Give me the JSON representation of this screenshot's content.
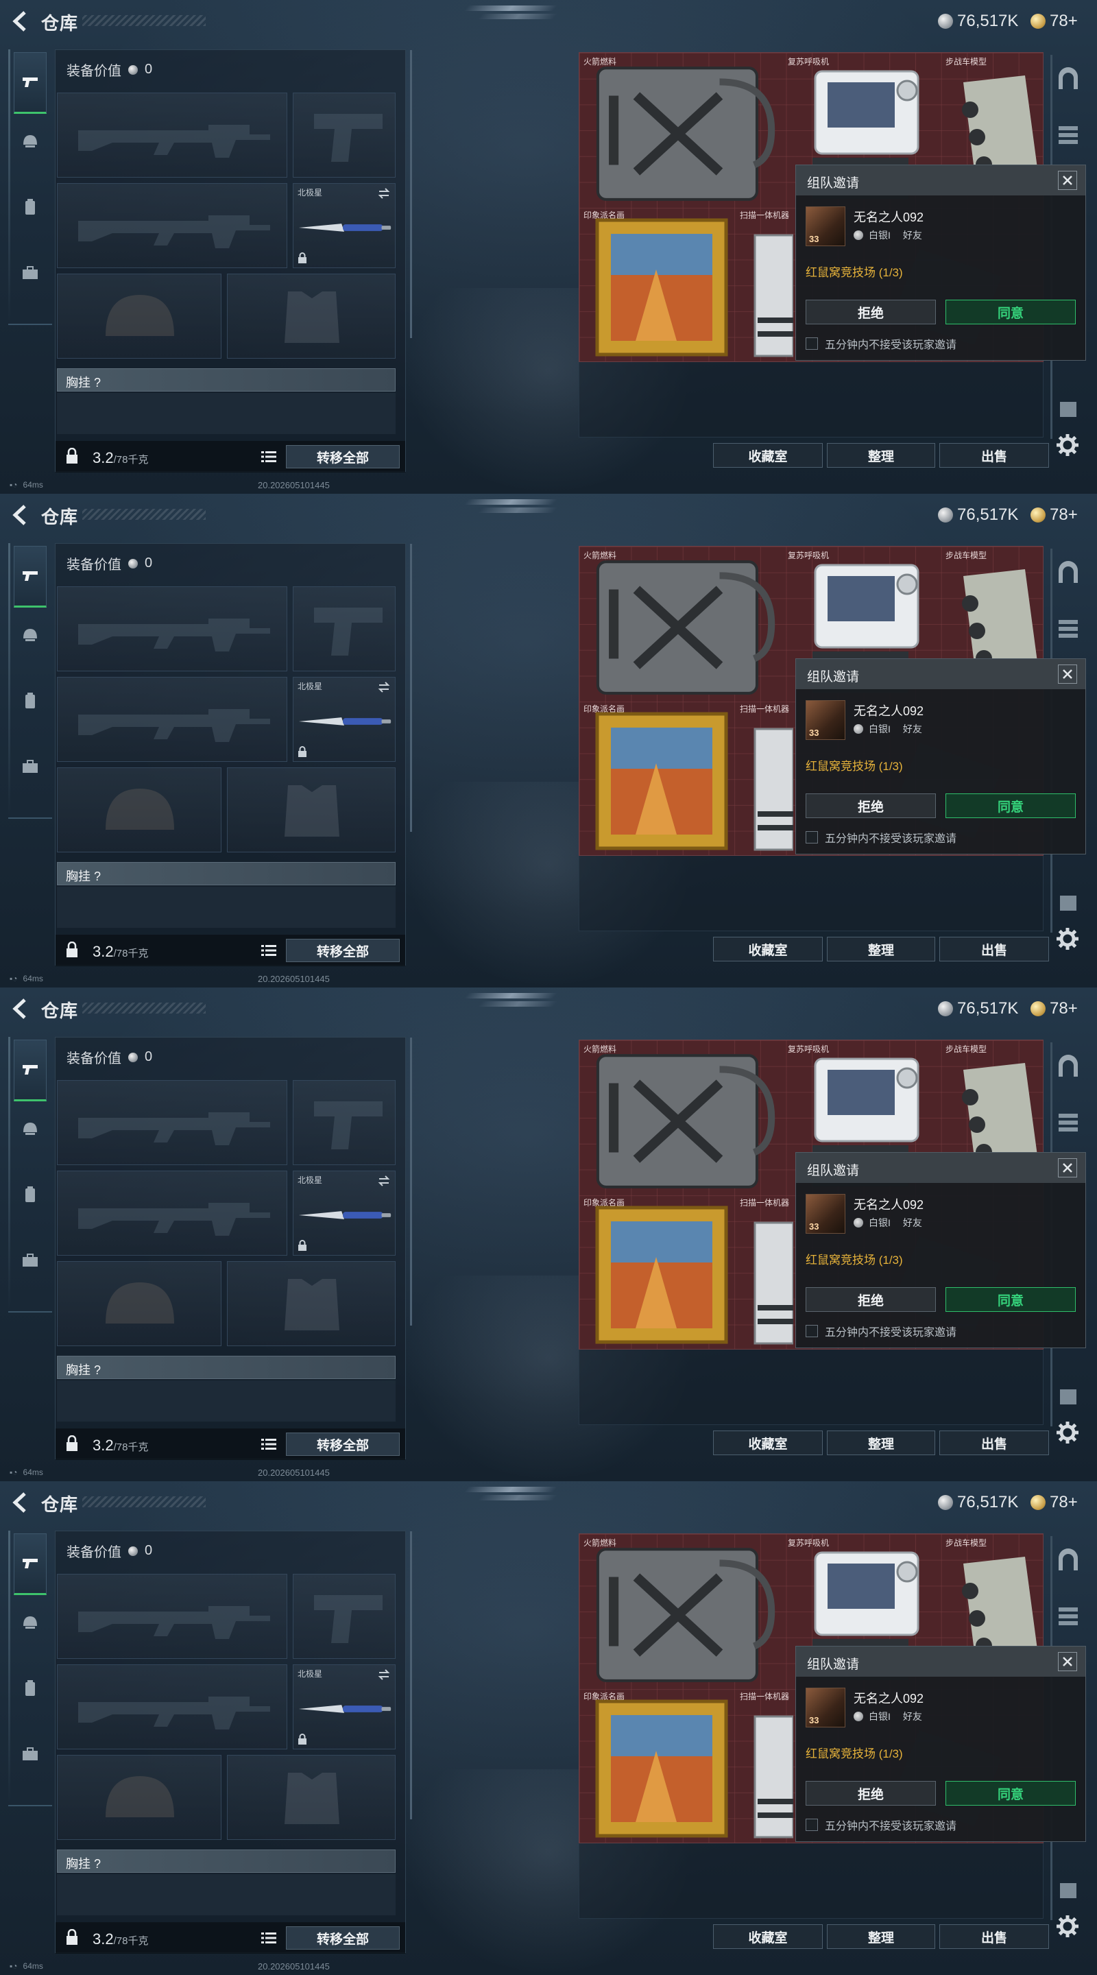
{
  "header": {
    "title": "仓库",
    "currency_silver": "76,517K",
    "currency_gold": "78+"
  },
  "equipment": {
    "value_label": "装备价值",
    "value": "0",
    "melee_slot_label": "北极星",
    "chest_label": "胸挂 ?",
    "weight_current": "3.2",
    "weight_max": "/78千克",
    "transfer_all": "转移全部"
  },
  "status": {
    "ping": "64ms",
    "build": "20.202605101445"
  },
  "storage": {
    "items": [
      {
        "label": "火箭燃料"
      },
      {
        "label": "复苏呼吸机"
      },
      {
        "label": "步战车模型"
      },
      {
        "label": "印象派名画"
      },
      {
        "label": "扫描一体机器"
      }
    ]
  },
  "actions": {
    "collection": "收藏室",
    "sort": "整理",
    "sell": "出售"
  },
  "invite": {
    "title": "组队邀请",
    "player_name": "无名之人092",
    "player_level": "33",
    "rank": "白银I",
    "relation": "好友",
    "mode": "红鼠窝竞技场 (1/3)",
    "reject": "拒绝",
    "accept": "同意",
    "option": "五分钟内不接受该玩家邀请"
  },
  "colors": {
    "accent_green": "#2fbf6b",
    "mode_gold": "#e6b23a",
    "storage_red": "#4e2428"
  }
}
